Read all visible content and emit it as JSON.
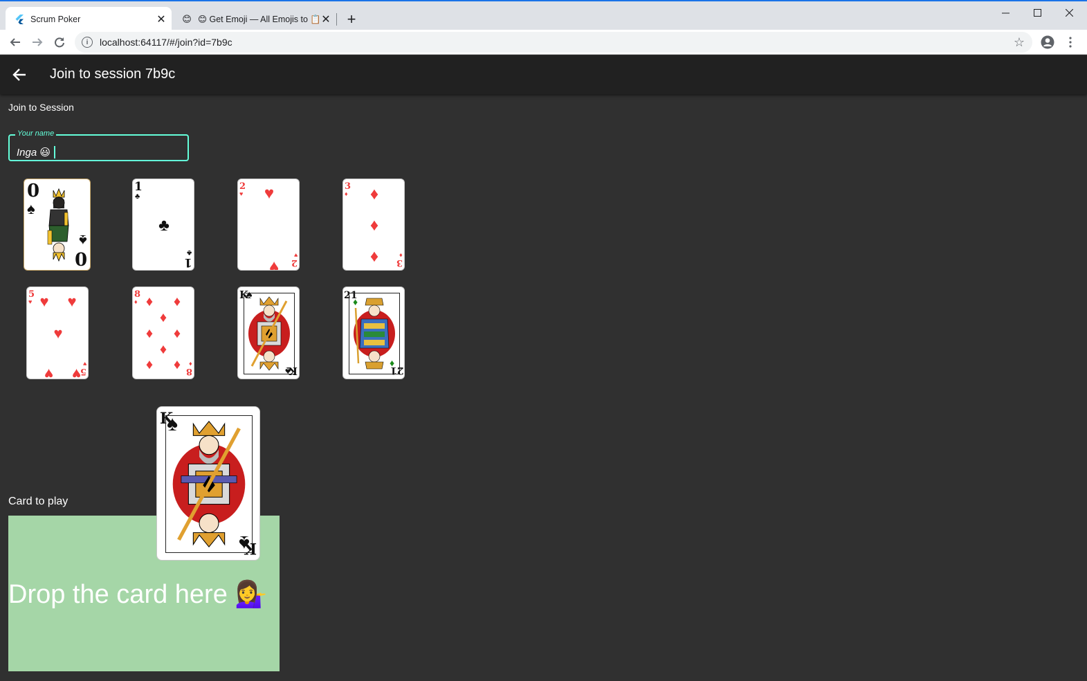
{
  "browser": {
    "tabs": [
      {
        "title": "Scrum Poker",
        "favicon": "flutter-icon",
        "active": true
      },
      {
        "title": "😊 Get Emoji — All Emojis to 📋",
        "favicon": "emoji-smile-icon",
        "active": false
      }
    ],
    "url": "localhost:64117/#/join?id=7b9c"
  },
  "app": {
    "title": "Join to session 7b9c",
    "section_label": "Join to Session",
    "name_field": {
      "label": "Your name",
      "value": "Inga 😃"
    },
    "cards": [
      {
        "rank": "0",
        "suit": "♠",
        "color": "black",
        "kind": "queen-face"
      },
      {
        "rank": "1",
        "suit": "♣",
        "color": "black",
        "kind": "pip"
      },
      {
        "rank": "2",
        "suit": "♥",
        "color": "red",
        "kind": "pip"
      },
      {
        "rank": "3",
        "suit": "♦",
        "color": "red",
        "kind": "pip"
      },
      {
        "rank": "5",
        "suit": "♥",
        "color": "red",
        "kind": "pip"
      },
      {
        "rank": "8",
        "suit": "♦",
        "color": "red",
        "kind": "pip"
      },
      {
        "rank": "K",
        "suit": "♠",
        "color": "black",
        "kind": "king-face"
      },
      {
        "rank": "21",
        "suit": "♦",
        "color": "green",
        "kind": "jack-face"
      }
    ],
    "dragged_card": {
      "rank": "K",
      "suit": "♠",
      "kind": "king-face"
    },
    "play_label": "Card to play",
    "drop_text": "Drop the card here 💁‍♀️"
  },
  "colors": {
    "background": "#303030",
    "appbar": "#212121",
    "accent": "#64ffda",
    "dropzone": "#a5d6a7"
  }
}
